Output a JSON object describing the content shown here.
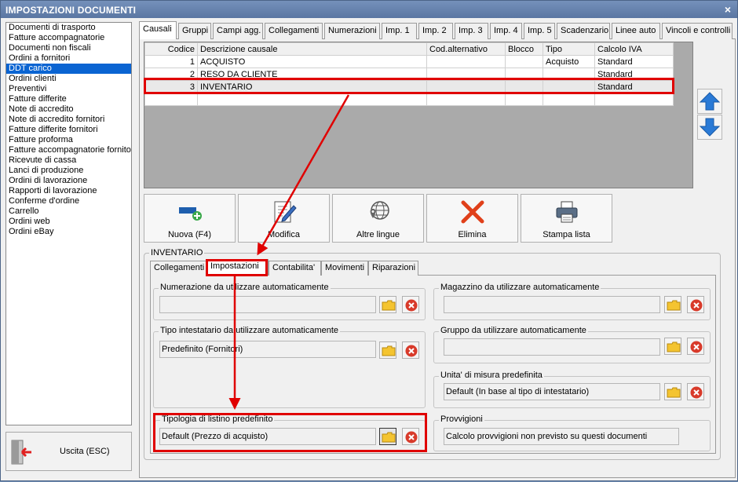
{
  "window": {
    "title": "IMPOSTAZIONI DOCUMENTI",
    "close_glyph": "×"
  },
  "sidebar": {
    "items": [
      "Documenti di trasporto",
      "Fatture accompagnatorie",
      "Documenti non fiscali",
      "Ordini a fornitori",
      "DDT carico",
      "Ordini clienti",
      "Preventivi",
      "Fatture differite",
      "Note di accredito",
      "Note di accredito fornitori",
      "Fatture differite fornitori",
      "Fatture proforma",
      "Fatture accompagnatorie fornitori",
      "Ricevute di cassa",
      "Lanci di produzione",
      "Ordini di lavorazione",
      "Rapporti di lavorazione",
      "Conferme d'ordine",
      "Carrello",
      "Ordini web",
      "Ordini eBay"
    ],
    "selected_index": 4,
    "exit_label": "Uscita (ESC)"
  },
  "top_tabs": [
    "Causali",
    "Gruppi",
    "Campi agg.",
    "Collegamenti",
    "Numerazioni",
    "Imp. 1",
    "Imp. 2",
    "Imp. 3",
    "Imp. 4",
    "Imp. 5",
    "Scadenzario",
    "Linee auto",
    "Vincoli e controlli"
  ],
  "grid": {
    "columns": [
      "Codice",
      "Descrizione causale",
      "Cod.alternativo",
      "Blocco",
      "Tipo",
      "Calcolo IVA"
    ],
    "rows": [
      [
        "1",
        "ACQUISTO",
        "",
        "",
        "Acquisto",
        "Standard"
      ],
      [
        "2",
        "RESO DA CLIENTE",
        "",
        "",
        "",
        "Standard"
      ],
      [
        "3",
        "INVENTARIO",
        "",
        "",
        "",
        "Standard"
      ]
    ]
  },
  "buttons": {
    "new": "Nuova (F4)",
    "edit": "Modifica",
    "languages": "Altre lingue",
    "delete": "Elimina",
    "print": "Stampa lista"
  },
  "detail": {
    "group_title": "INVENTARIO",
    "tabs": [
      "Collegamenti",
      "Impostazioni",
      "Contabilita'",
      "Movimenti",
      "Riparazioni"
    ],
    "boxes": {
      "numerazione": {
        "label": "Numerazione da utilizzare automaticamente",
        "value": ""
      },
      "intestatario": {
        "label": "Tipo intestatario da utilizzare automaticamente",
        "value": "Predefinito (Fornitori)"
      },
      "listino": {
        "label": "Tipologia di listino predefinito",
        "value": "Default (Prezzo di acquisto)"
      },
      "magazzino": {
        "label": "Magazzino da utilizzare automaticamente",
        "value": ""
      },
      "gruppo": {
        "label": "Gruppo da utilizzare automaticamente",
        "value": ""
      },
      "unita": {
        "label": "Unita' di misura predefinita",
        "value": "Default (In base al tipo di intestatario)"
      },
      "provvigioni": {
        "label": "Provvigioni",
        "value": "Calcolo provvigioni non previsto su questi documenti"
      }
    }
  },
  "colors": {
    "title_bar": "#5a76a2",
    "selection": "#0a64d2",
    "highlight": "#e00000"
  }
}
